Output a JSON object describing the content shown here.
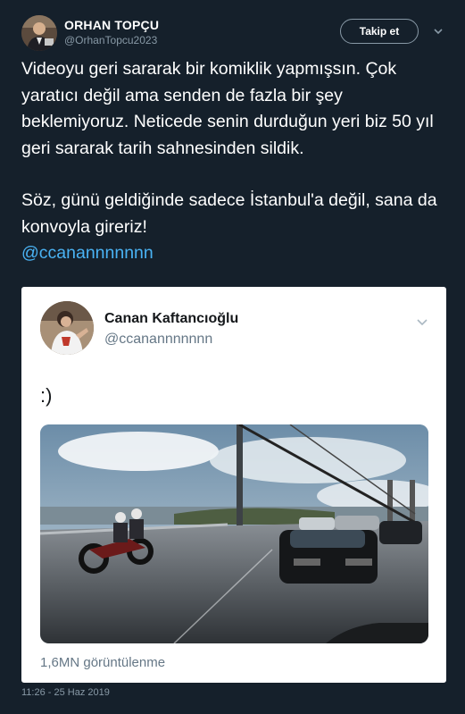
{
  "author": {
    "display_name": "ORHAN TOPÇU",
    "handle": "@OrhanTopcu2023"
  },
  "follow_label": "Takip et",
  "tweet": {
    "paragraph1": "Videoyu geri sararak bir komiklik yapmışsın. Çok yaratıcı değil ama senden de fazla bir şey beklemiyoruz. Neticede senin durduğun yeri biz 50 yıl geri sararak tarih sahnesinden sildik.",
    "paragraph2": "Söz, günü geldiğinde sadece İstanbul'a değil, sana da konvoyla gireriz!",
    "mention": "@ccanannnnnnn"
  },
  "quoted": {
    "display_name": "Canan Kaftancıoğlu",
    "handle": "@ccanannnnnnn",
    "text": ":)",
    "views": "1,6MN görüntülenme"
  },
  "timestamp": "11:26 - 25 Haz 2019",
  "icons": {
    "more": "chevron-down-icon"
  },
  "colors": {
    "background": "#15202b",
    "link": "#4ab3f4",
    "secondary_text": "#8899a6"
  }
}
